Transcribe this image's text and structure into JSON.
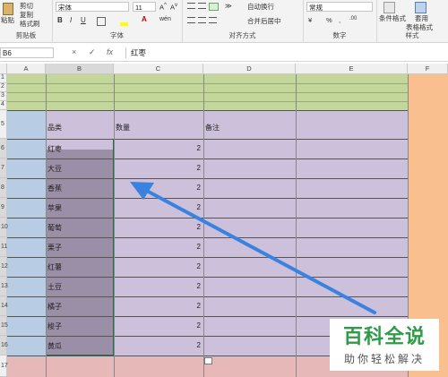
{
  "ribbon": {
    "clipboard": {
      "cut": "剪切",
      "paste": "粘贴",
      "copy": "复制",
      "format_painter": "格式刷",
      "group": "剪贴板"
    },
    "font": {
      "name": "宋体",
      "size": "11",
      "bold": "B",
      "italic": "I",
      "underline": "U",
      "group": "字体",
      "wen": "wén"
    },
    "alignment": {
      "wrap": "自动换行",
      "merge": "合并后居中",
      "group": "对齐方式"
    },
    "number": {
      "format": "常规",
      "percent": "%",
      "comma": ",",
      "group": "数字"
    },
    "styles": {
      "conditional": "条件格式",
      "table_format_top": "套用",
      "table_format": "表格格式",
      "group": "样式"
    }
  },
  "formula_bar": {
    "name_box": "B6",
    "cancel": "×",
    "confirm": "✓",
    "fx": "fx",
    "content": "红枣"
  },
  "columns": [
    "A",
    "B",
    "C",
    "D",
    "E",
    "F"
  ],
  "rows": [
    "1",
    "2",
    "3",
    "4",
    "5",
    "6",
    "7",
    "8",
    "9",
    "10",
    "11",
    "12",
    "13",
    "14",
    "15",
    "16",
    "17"
  ],
  "table": {
    "headers": {
      "category": "品类",
      "quantity": "数量",
      "note": "备注"
    },
    "items": [
      {
        "name": "红枣",
        "qty": "2"
      },
      {
        "name": "大豆",
        "qty": "2"
      },
      {
        "name": "香蕉",
        "qty": "2"
      },
      {
        "name": "苹果",
        "qty": "2"
      },
      {
        "name": "葡萄",
        "qty": "2"
      },
      {
        "name": "栗子",
        "qty": "2"
      },
      {
        "name": "红薯",
        "qty": "2"
      },
      {
        "name": "土豆",
        "qty": "2"
      },
      {
        "name": "橘子",
        "qty": "2"
      },
      {
        "name": "梭子",
        "qty": "2"
      },
      {
        "name": "黄瓜",
        "qty": "2"
      }
    ]
  },
  "watermark": {
    "title": "百科全说",
    "subtitle": "助你轻松解决"
  },
  "colors": {
    "green": "#c4d79b",
    "lavender": "#ccc0da",
    "blue": "#b8cce4",
    "orange": "#fabf8f",
    "pink": "#e6b8b7",
    "selection": "#9a8fa7",
    "arrow": "#3a82e0"
  }
}
